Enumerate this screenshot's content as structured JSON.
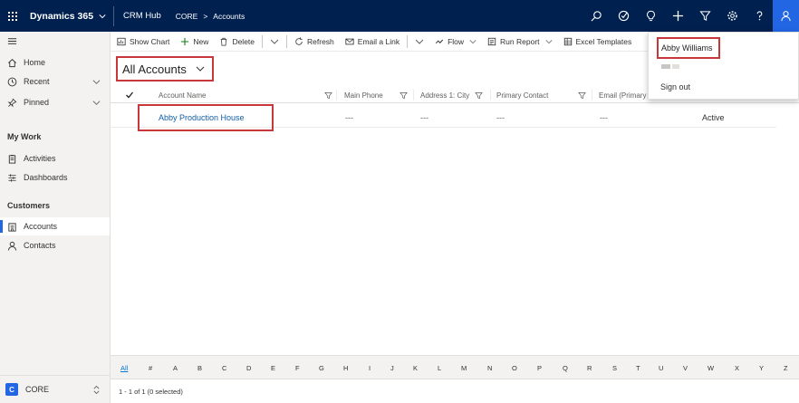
{
  "topbar": {
    "brand": "Dynamics 365",
    "app": "CRM Hub",
    "crumbs": [
      "CORE",
      ">",
      "Accounts"
    ],
    "icons": [
      "search-icon",
      "task-icon",
      "lightbulb-icon",
      "plus-icon",
      "filter-icon",
      "gear-icon",
      "help-icon",
      "user-icon"
    ]
  },
  "sidebar": {
    "items": [
      {
        "label": "Home",
        "icon": "home-icon"
      },
      {
        "label": "Recent",
        "icon": "clock-icon"
      },
      {
        "label": "Pinned",
        "icon": "pin-icon"
      }
    ],
    "my_work_label": "My Work",
    "my_work": [
      {
        "label": "Activities",
        "icon": "clipboard-icon"
      },
      {
        "label": "Dashboards",
        "icon": "dashboard-icon"
      }
    ],
    "customers_label": "Customers",
    "customers": [
      {
        "label": "Accounts",
        "icon": "building-icon"
      },
      {
        "label": "Contacts",
        "icon": "person-icon"
      }
    ],
    "area": {
      "badge": "C",
      "label": "CORE"
    }
  },
  "commands": {
    "show_chart": "Show Chart",
    "new": "New",
    "delete": "Delete",
    "refresh": "Refresh",
    "email_link": "Email a Link",
    "flow": "Flow",
    "run_report": "Run Report",
    "excel_templates": "Excel Templates"
  },
  "view": {
    "title": "All Accounts"
  },
  "grid": {
    "columns": [
      "Account Name",
      "Main Phone",
      "Address 1: City",
      "Primary Contact",
      "Email (Primary C"
    ],
    "rows": [
      {
        "name": "Abby Production House",
        "phone": "---",
        "city": "---",
        "contact": "---",
        "email": "---",
        "status": "Active"
      }
    ]
  },
  "profile": {
    "name": "Abby Williams",
    "sign_out": "Sign out"
  },
  "jumpbar": {
    "letters": [
      "All",
      "#",
      "A",
      "B",
      "C",
      "D",
      "E",
      "F",
      "G",
      "H",
      "I",
      "J",
      "K",
      "L",
      "M",
      "N",
      "O",
      "P",
      "Q",
      "R",
      "S",
      "T",
      "U",
      "V",
      "W",
      "X",
      "Y",
      "Z"
    ]
  },
  "status": {
    "text": "1 - 1 of 1 (0 selected)"
  },
  "colors": {
    "nav": "#002050",
    "accent": "#2266e3",
    "highlight": "#c8383a",
    "link": "#115ea3"
  }
}
